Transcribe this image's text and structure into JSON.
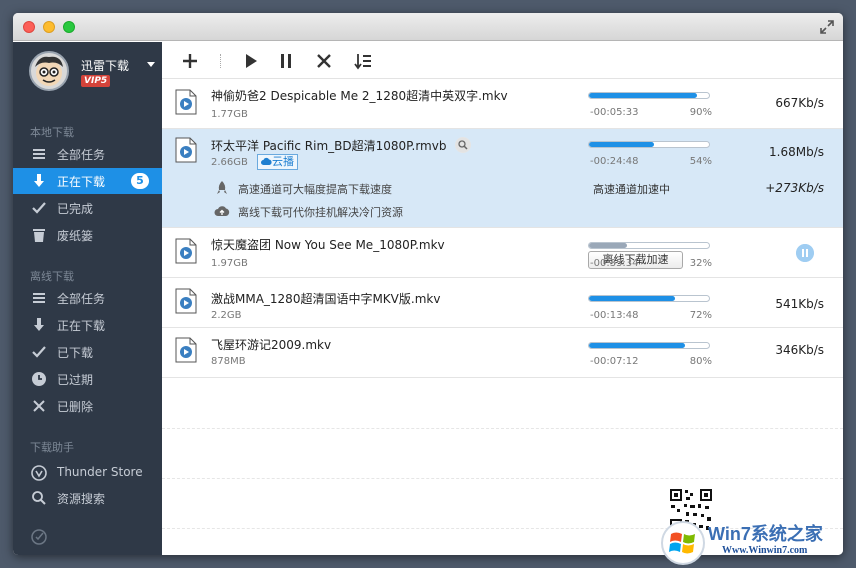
{
  "sidebar": {
    "username": "迅雷下载",
    "vip": "VIP5",
    "section_local": "本地下载",
    "section_offline": "离线下载",
    "section_helper": "下载助手",
    "local_items": [
      {
        "label": "全部任务",
        "icon": "list-icon"
      },
      {
        "label": "正在下载",
        "icon": "download-arrow-icon",
        "badge": "5",
        "active": true
      },
      {
        "label": "已完成",
        "icon": "check-icon"
      },
      {
        "label": "废纸篓",
        "icon": "trash-icon"
      }
    ],
    "offline_items": [
      {
        "label": "全部任务",
        "icon": "list-icon"
      },
      {
        "label": "正在下载",
        "icon": "download-arrow-icon"
      },
      {
        "label": "已下载",
        "icon": "check-icon"
      },
      {
        "label": "已过期",
        "icon": "clock-icon"
      },
      {
        "label": "已删除",
        "icon": "x-icon"
      }
    ],
    "helper_items": [
      {
        "label": "Thunder Store",
        "icon": "store-icon"
      },
      {
        "label": "资源搜索",
        "icon": "search-icon"
      }
    ]
  },
  "downloads": [
    {
      "name": "神偷奶爸2 Despicable Me 2_1280超清中英双字.mkv",
      "size": "1.77GB",
      "time": "-00:05:33",
      "percent": "90%",
      "progress": 0.9,
      "speed": "667Kb/s"
    },
    {
      "name": "环太平洋 Pacific Rim_BD超清1080P.rmvb",
      "size": "2.66GB",
      "time": "-00:24:48",
      "percent": "54%",
      "progress": 0.54,
      "speed": "1.68Mb/s",
      "cloud_tag": "云播",
      "boost_line": "高速通道可大幅度提高下载速度",
      "boost_status": "高速通道加速中",
      "boost_speed": "+273Kb/s",
      "offline_line": "离线下载可代你挂机解决冷门资源",
      "offline_button": "离线下载加速"
    },
    {
      "name": "惊天魔盗团 Now You See Me_1080P.mkv",
      "size": "1.97GB",
      "time": "-00:35:34",
      "percent": "32%",
      "progress": 0.32,
      "paused": true
    },
    {
      "name": "激战MMA_1280超清国语中字MKV版.mkv",
      "size": "2.2GB",
      "time": "-00:13:48",
      "percent": "72%",
      "progress": 0.72,
      "speed": "541Kb/s"
    },
    {
      "name": "飞屋环游记2009.mkv",
      "size": "878MB",
      "time": "-00:07:12",
      "percent": "80%",
      "progress": 0.8,
      "speed": "346Kb/s"
    }
  ],
  "watermark": {
    "brand": "Win7系统之家",
    "url": "Www.Winwin7.com"
  },
  "colors": {
    "accent": "#1e90e6",
    "sidebar_bg": "#2f3947",
    "selected_row": "#d7e8f7"
  }
}
